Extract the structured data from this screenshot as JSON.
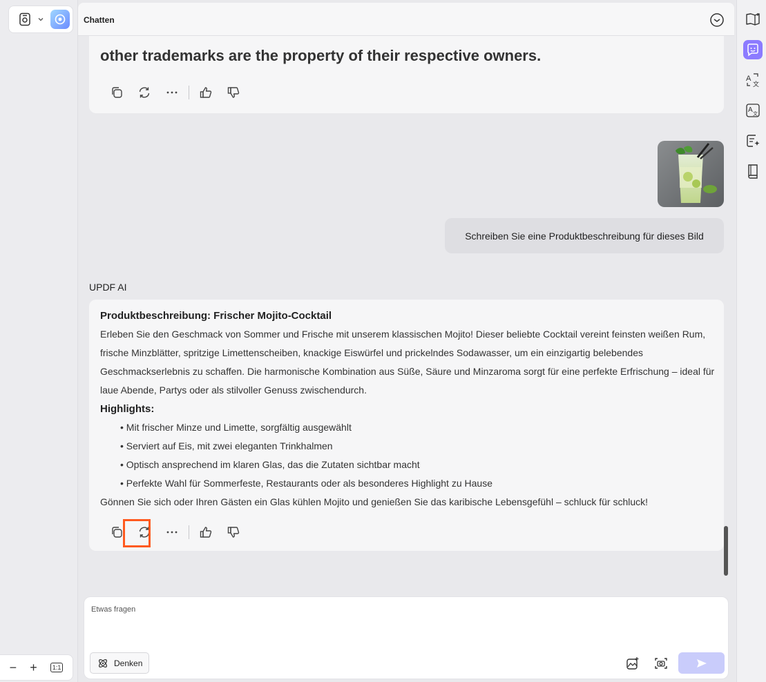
{
  "left_panel": {
    "zoom_out": "−",
    "zoom_in": "+",
    "actual_size": "1:1"
  },
  "chat": {
    "title": "Chatten",
    "prev_message_tail": "other trademarks are the property of their respective owners.",
    "user_prompt": "Schreiben Sie eine Produktbeschreibung für dieses Bild",
    "ai_label": "UPDF AI",
    "response": {
      "title": "Produktbeschreibung: Frischer Mojito-Cocktail",
      "paragraph": "Erleben Sie den Geschmack von Sommer und Frische mit unserem klassischen Mojito! Dieser beliebte Cocktail vereint feinsten weißen Rum, frische Minzblätter, spritzige Limettenscheiben, knackige Eiswürfel und prickelndes Sodawasser, um ein einzigartig belebendes Geschmackserlebnis zu schaffen. Die harmonische Kombination aus Süße, Säure und Minzaroma sorgt für eine perfekte Erfrischung – ideal für laue Abende, Partys oder als stilvoller Genuss zwischendurch.",
      "highlights_title": "Highlights:",
      "highlights": [
        "Mit frischer Minze und Limette, sorgfältig ausgewählt",
        "Serviert auf Eis, mit zwei eleganten Trinkhalmen",
        "Optisch ansprechend im klaren Glas, das die Zutaten sichtbar macht",
        "Perfekte Wahl für Sommerfeste, Restaurants oder als besonderes Highlight zu Hause"
      ],
      "closing": "Gönnen Sie sich oder Ihren Gästen ein Glas kühlen Mojito und genießen Sie das karibische Lebensgefühl – schluck für schluck!"
    }
  },
  "composer": {
    "placeholder": "Etwas fragen",
    "think_label": "Denken"
  },
  "colors": {
    "accent": "#8c7bff",
    "highlight": "#ff5a1f",
    "send_disabled": "#c9ccfb"
  }
}
